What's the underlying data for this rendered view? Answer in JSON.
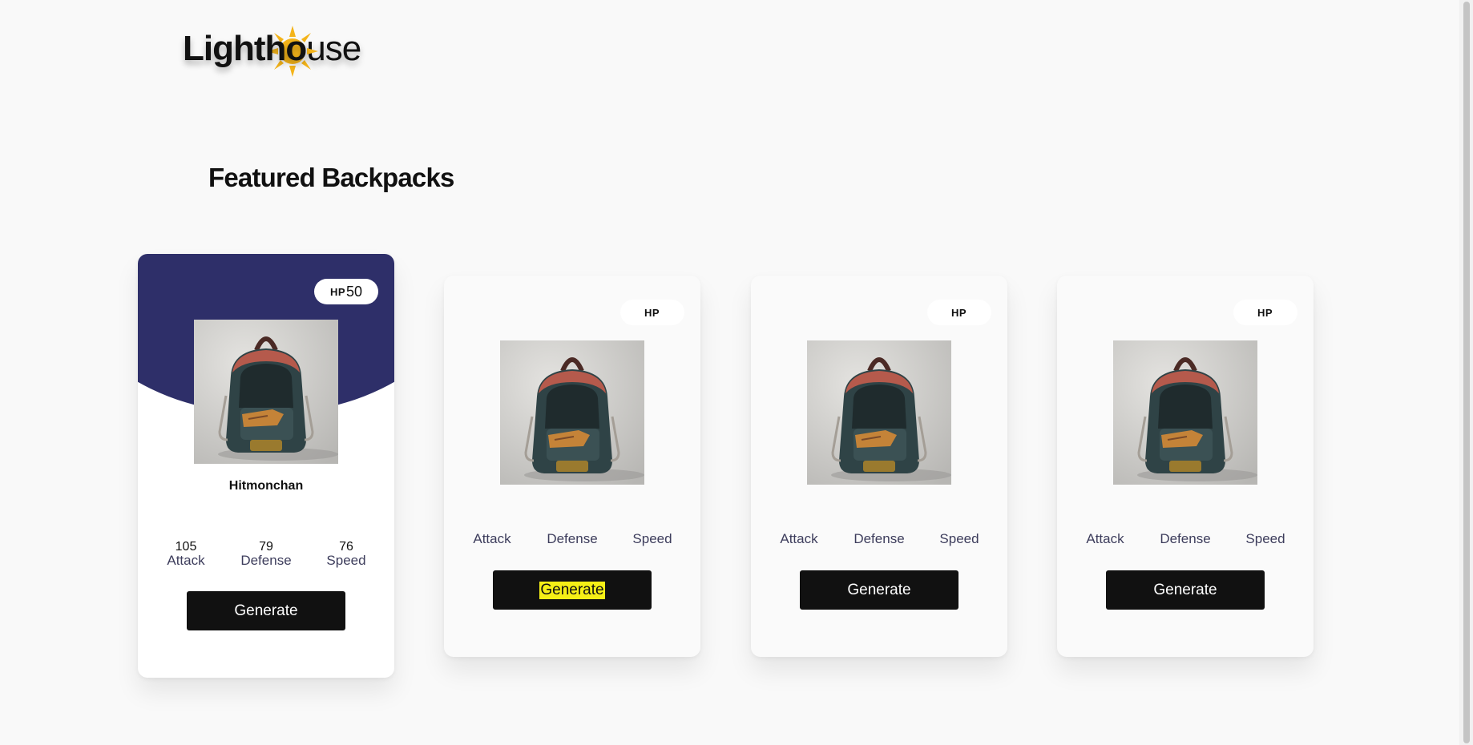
{
  "logo": {
    "part1": "Light",
    "part2": "ho",
    "part3": "use"
  },
  "section_title": "Featured Backpacks",
  "cards": [
    {
      "featured": true,
      "hp_label": "HP",
      "hp_value": "50",
      "name": "Hitmonchan",
      "stats": [
        {
          "value": "105",
          "label": "Attack"
        },
        {
          "value": "79",
          "label": "Defense"
        },
        {
          "value": "76",
          "label": "Speed"
        }
      ],
      "button_label": "Generate"
    },
    {
      "featured": false,
      "hp_label": "HP",
      "hp_value": "",
      "name": "",
      "stats": [
        {
          "value": "",
          "label": "Attack"
        },
        {
          "value": "",
          "label": "Defense"
        },
        {
          "value": "",
          "label": "Speed"
        }
      ],
      "button_label": "Generate",
      "button_highlighted": true
    },
    {
      "featured": false,
      "hp_label": "HP",
      "hp_value": "",
      "name": "",
      "stats": [
        {
          "value": "",
          "label": "Attack"
        },
        {
          "value": "",
          "label": "Defense"
        },
        {
          "value": "",
          "label": "Speed"
        }
      ],
      "button_label": "Generate"
    },
    {
      "featured": false,
      "hp_label": "HP",
      "hp_value": "",
      "name": "",
      "stats": [
        {
          "value": "",
          "label": "Attack"
        },
        {
          "value": "",
          "label": "Defense"
        },
        {
          "value": "",
          "label": "Speed"
        }
      ],
      "button_label": "Generate"
    }
  ],
  "colors": {
    "featured_header": "#2e2f69",
    "button_bg": "#111111",
    "highlight": "#f5ef16",
    "sun": "#f4b41a"
  },
  "icons": {
    "logo_sun": "sun-icon",
    "card_image": "backpack-image"
  }
}
